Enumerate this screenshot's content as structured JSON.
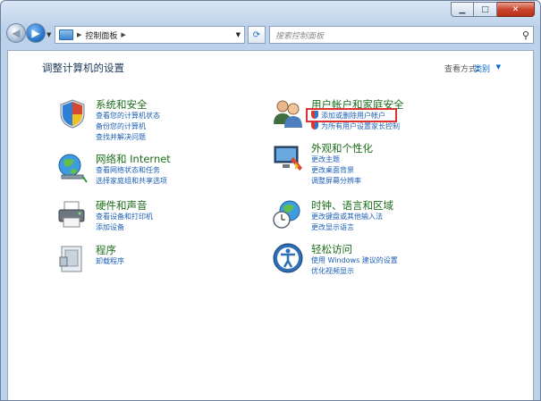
{
  "address": {
    "crumb": "控制面板"
  },
  "search": {
    "placeholder": "搜索控制面板"
  },
  "header": {
    "title": "调整计算机的设置",
    "viewby_label": "查看方式:",
    "viewby_value": "类别"
  },
  "categories": [
    {
      "title": "系统和安全",
      "links": [
        "查看您的计算机状态",
        "备份您的计算机",
        "查找并解决问题"
      ]
    },
    {
      "title": "网络和 Internet",
      "links": [
        "查看网络状态和任务",
        "选择家庭组和共享选项"
      ]
    },
    {
      "title": "硬件和声音",
      "links": [
        "查看设备和打印机",
        "添加设备"
      ]
    },
    {
      "title": "程序",
      "links": [
        "卸载程序"
      ]
    },
    {
      "title": "用户帐户和家庭安全",
      "links": [
        "添加或删除用户帐户",
        "为所有用户设置家长控制"
      ]
    },
    {
      "title": "外观和个性化",
      "links": [
        "更改主题",
        "更改桌面背景",
        "调整屏幕分辨率"
      ]
    },
    {
      "title": "时钟、语言和区域",
      "links": [
        "更改键盘或其他输入法",
        "更改显示语言"
      ]
    },
    {
      "title": "轻松访问",
      "links": [
        "使用 Windows 建议的设置",
        "优化视频显示"
      ]
    }
  ],
  "colors": {
    "category_title": "#1d6d1d",
    "link": "#1c5fb5",
    "highlight": "#e03030"
  }
}
